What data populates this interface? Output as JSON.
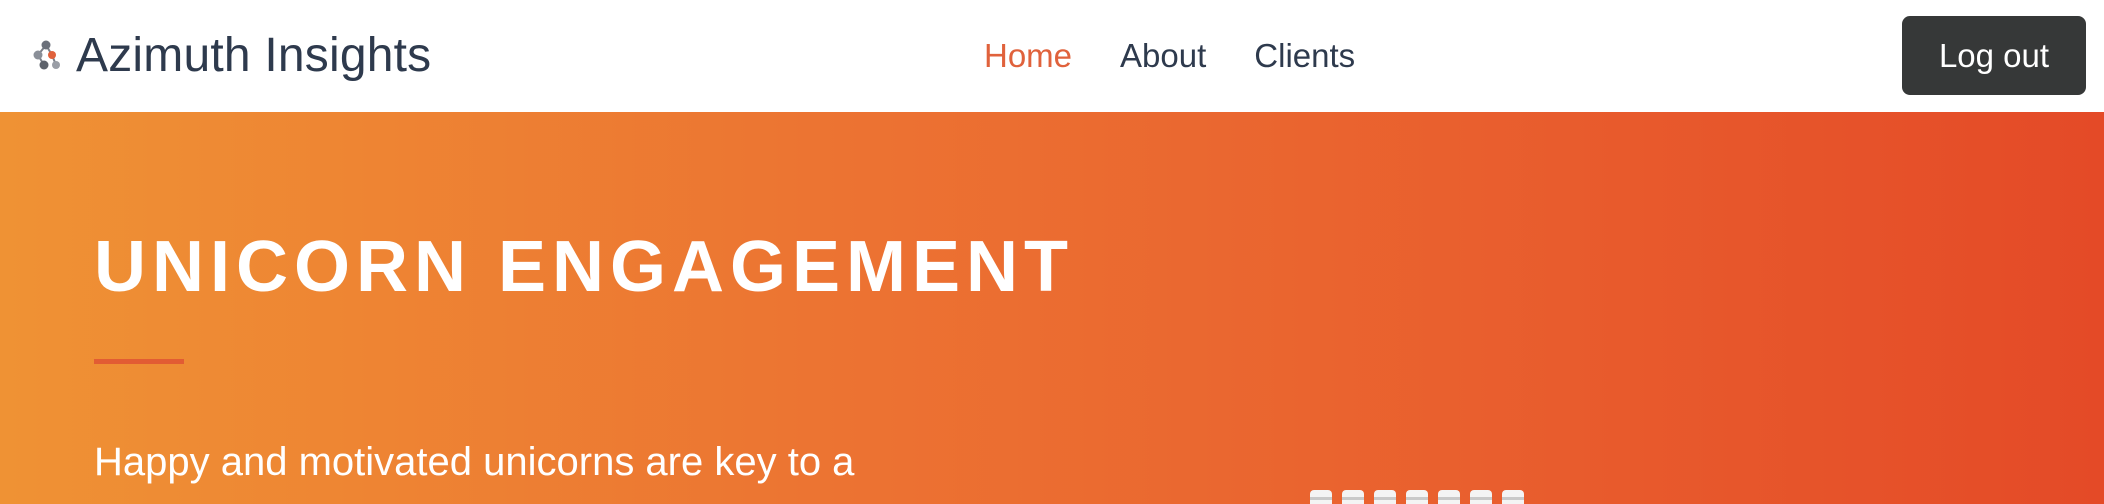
{
  "header": {
    "brand_name": "Azimuth Insights",
    "brand_logo_icon": "molecule-icon",
    "nav": [
      {
        "label": "Home",
        "active": true
      },
      {
        "label": "About",
        "active": false
      },
      {
        "label": "Clients",
        "active": false
      }
    ],
    "logout_label": "Log out"
  },
  "hero": {
    "title": "UNICORN ENGAGEMENT",
    "text": "Happy and motivated unicorns are key to a",
    "gradient_colors": [
      "#ef9234",
      "#e44a27"
    ]
  },
  "colors": {
    "accent": "#e0623c",
    "text_dark": "#2e3a4d",
    "button_bg": "#363838"
  }
}
